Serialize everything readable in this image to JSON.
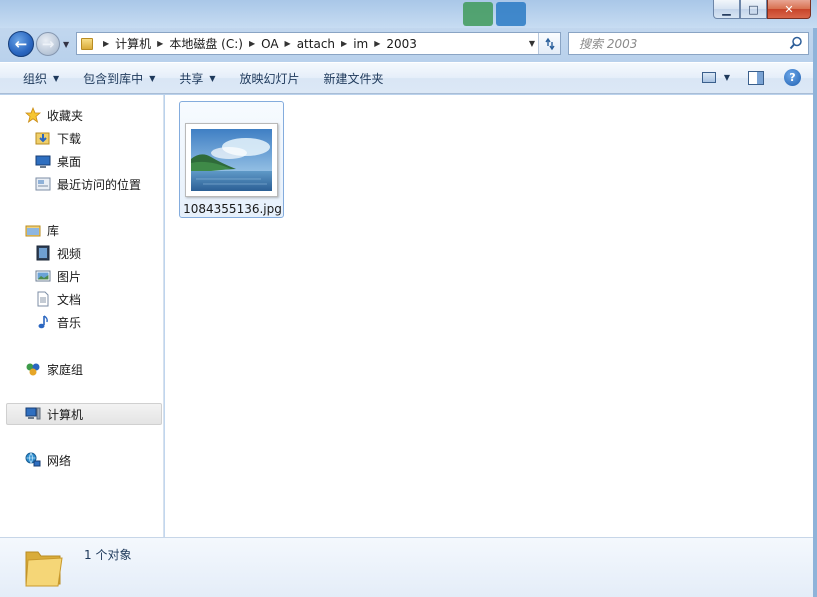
{
  "window": {
    "caption": {
      "minimize": "▁",
      "maximize": "□",
      "close": "✕"
    }
  },
  "navigation": {
    "back_icon": "back-arrow-icon",
    "forward_icon": "forward-arrow-icon",
    "breadcrumb": [
      "计算机",
      "本地磁盘 (C:)",
      "OA",
      "attach",
      "im",
      "2003"
    ],
    "search_placeholder": "搜索 2003"
  },
  "commands": {
    "organize": "组织",
    "include_in_library": "包含到库中",
    "share": "共享",
    "slideshow": "放映幻灯片",
    "new_folder": "新建文件夹",
    "help": "?"
  },
  "sidebar": {
    "favorites": {
      "label": "收藏夹",
      "items": [
        "下载",
        "桌面",
        "最近访问的位置"
      ]
    },
    "libraries": {
      "label": "库",
      "items": [
        "视频",
        "图片",
        "文档",
        "音乐"
      ]
    },
    "homegroup": "家庭组",
    "computer": "计算机",
    "network": "网络"
  },
  "files": [
    {
      "name": "1084355136.jpg",
      "type": "image"
    }
  ],
  "status": {
    "count_text": "1 个对象"
  },
  "colors": {
    "accent": "#2a66c0",
    "selection_border": "#84acdd"
  }
}
